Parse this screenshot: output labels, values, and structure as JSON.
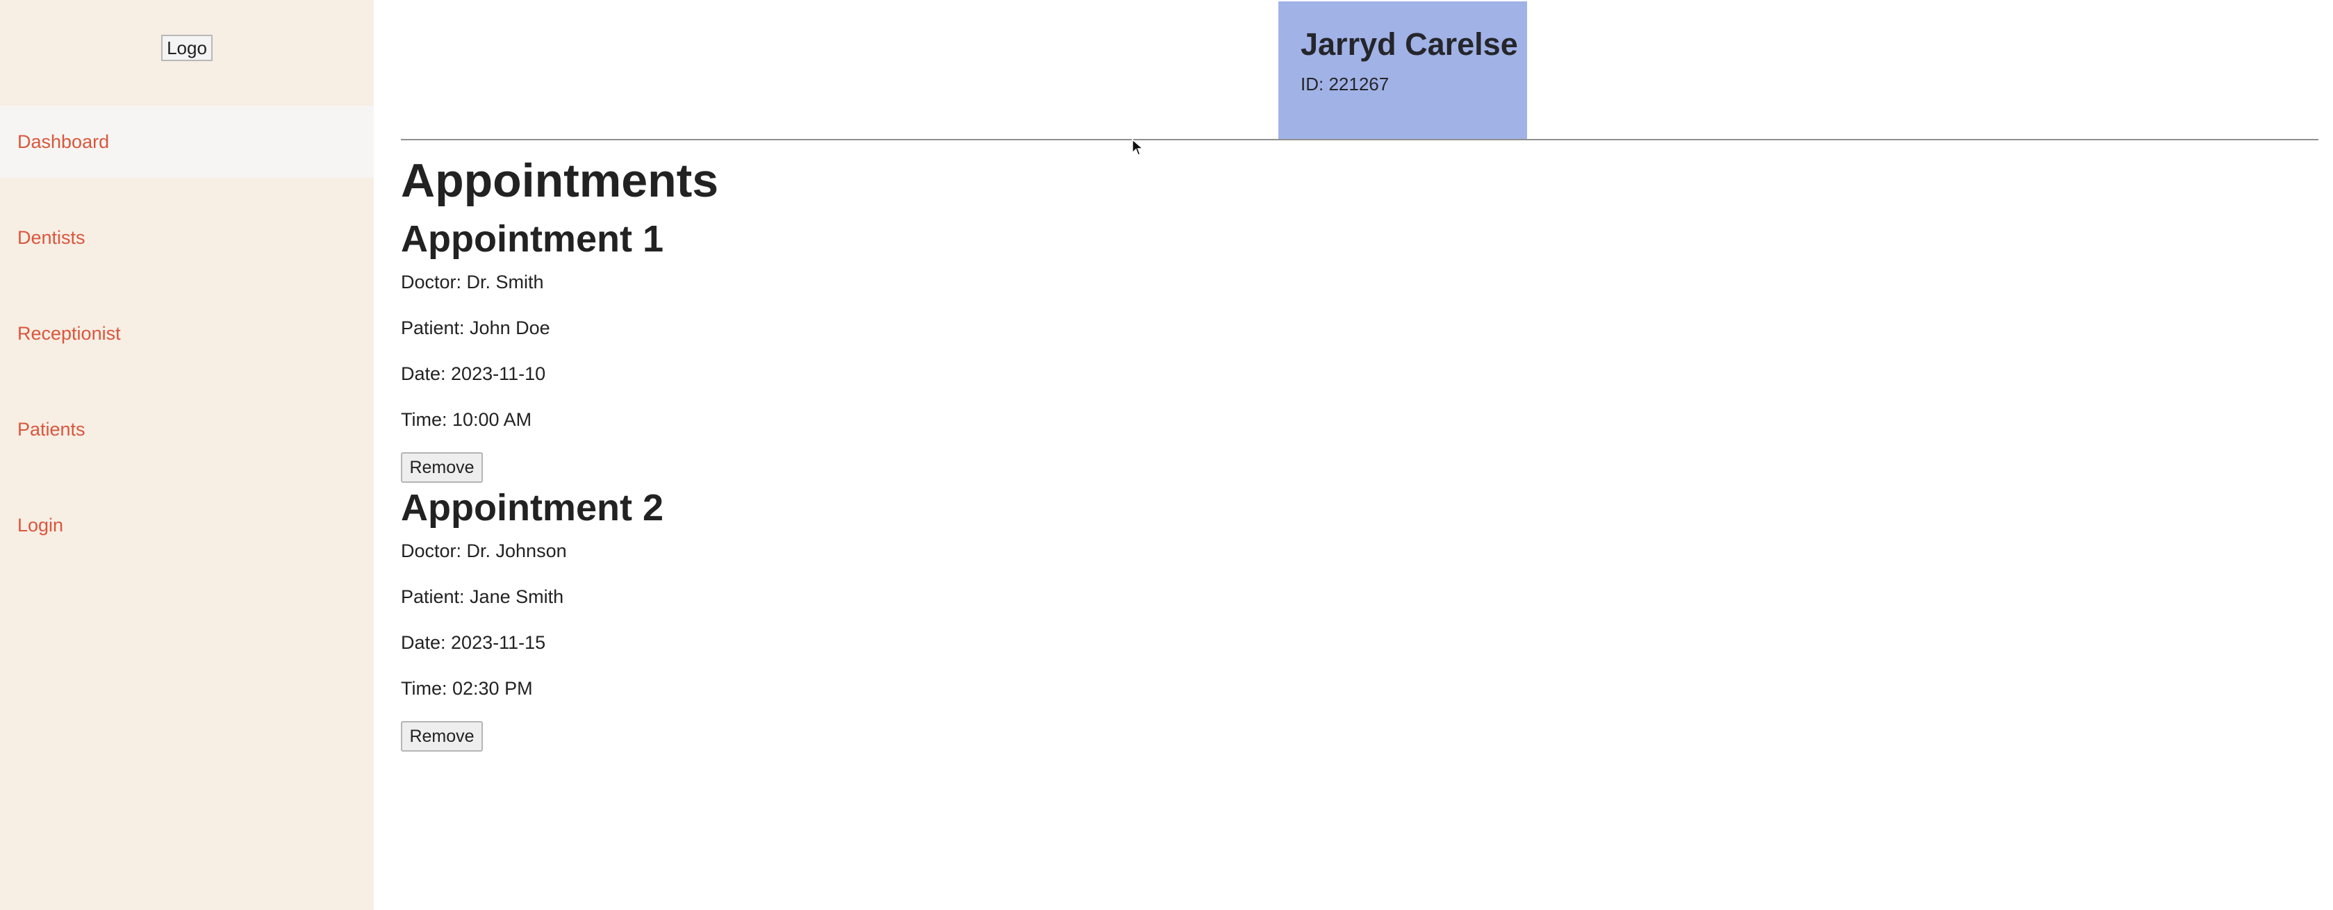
{
  "sidebar": {
    "logo_label": "Logo",
    "items": [
      {
        "label": "Dashboard",
        "active": true
      },
      {
        "label": "Dentists",
        "active": false
      },
      {
        "label": "Receptionist",
        "active": false
      },
      {
        "label": "Patients",
        "active": false
      },
      {
        "label": "Login",
        "active": false
      }
    ],
    "link_color": "#d9573d",
    "background": "#f7eee4"
  },
  "profile": {
    "name": "Jarryd Carelse",
    "id_text": "ID: 221267",
    "background": "#a1b2e6"
  },
  "main": {
    "title": "Appointments",
    "appointments": [
      {
        "heading": "Appointment 1",
        "doctor": "Doctor: Dr. Smith",
        "patient": "Patient: John Doe",
        "date": "Date: 2023-11-10",
        "time": "Time: 10:00 AM",
        "remove_label": "Remove"
      },
      {
        "heading": "Appointment 2",
        "doctor": "Doctor: Dr. Johnson",
        "patient": "Patient: Jane Smith",
        "date": "Date: 2023-11-15",
        "time": "Time: 02:30 PM",
        "remove_label": "Remove"
      }
    ]
  }
}
